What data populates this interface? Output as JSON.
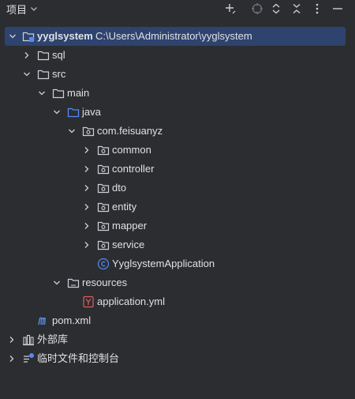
{
  "header": {
    "title": "项目"
  },
  "tree": {
    "root": {
      "name": "yyglsystem",
      "path": "C:\\Users\\Administrator\\yyglsystem"
    },
    "sql": "sql",
    "src": "src",
    "main": "main",
    "java": "java",
    "package": "com.feisuanyz",
    "subpackages": [
      "common",
      "controller",
      "dto",
      "entity",
      "mapper",
      "service"
    ],
    "app_class": "YyglsystemApplication",
    "resources": "resources",
    "app_yml": "application.yml",
    "pom": "pom.xml",
    "external_libs": "外部库",
    "scratches": "临时文件和控制台"
  },
  "icons": {
    "folder": "folder-icon",
    "module": "module-folder-icon",
    "source_root": "source-root-icon",
    "package": "package-icon",
    "class": "class-icon",
    "yaml": "yaml-file-icon",
    "maven": "maven-icon",
    "libraries": "libraries-icon",
    "scratches": "scratches-icon"
  },
  "colors": {
    "background": "#2b2d30",
    "selection": "#2e436e",
    "text": "#dfe1e5",
    "icon_gray": "#9da0a8",
    "source_blue": "#548af7",
    "class_blue": "#548af7",
    "yaml_red": "#d95f5f",
    "maven_blue": "#5a8de0"
  }
}
